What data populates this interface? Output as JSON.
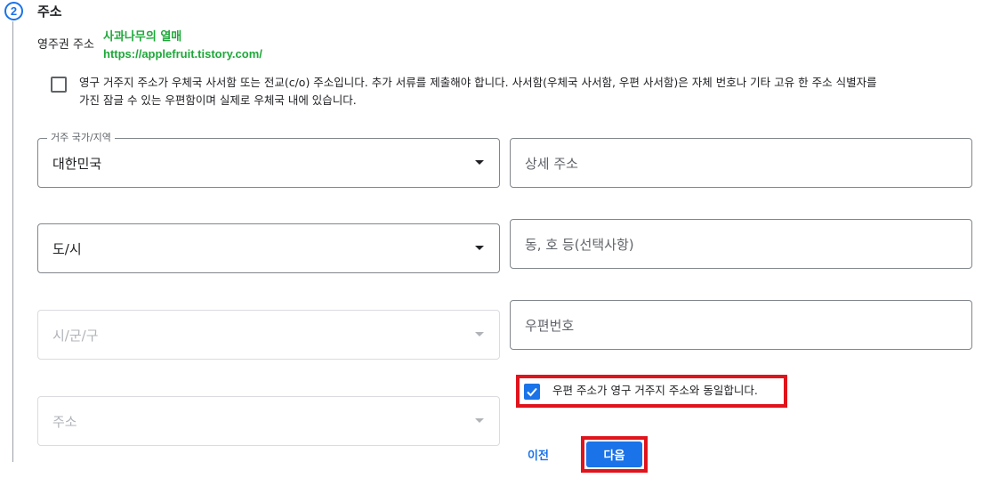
{
  "step": {
    "number": "2",
    "title": "주소"
  },
  "residency_label": "영주권 주소",
  "watermark": {
    "name": "사과나무의 열매",
    "url": "https://applefruit.tistory.com/"
  },
  "po_box": {
    "checked": false,
    "text": "영구 거주지 주소가 우체국 사서함 또는 전교(c/o) 주소입니다. 추가 서류를 제출해야 합니다. 사서함(우체국 사서함, 우편 사서함)은 자체 번호나 기타 고유 한 주소 식별자를 가진 잠글 수 있는 우편함이며 실제로 우체국 내에 있습니다."
  },
  "fields": {
    "country": {
      "label": "거주 국가/지역",
      "value": "대한민국"
    },
    "state": {
      "placeholder": "도/시"
    },
    "city": {
      "placeholder": "시/군/구"
    },
    "address": {
      "placeholder": "주소"
    },
    "detail_address": {
      "placeholder": "상세 주소"
    },
    "unit": {
      "placeholder": "동, 호 등(선택사항)"
    },
    "postal_code": {
      "placeholder": "우편번호"
    }
  },
  "same_address": {
    "checked": true,
    "text": "우편 주소가 영구 거주지 주소와 동일합니다."
  },
  "buttons": {
    "prev": "이전",
    "next": "다음"
  },
  "colors": {
    "accent": "#1a73e8",
    "highlight": "#e0141c",
    "watermark": "#1ea83a"
  }
}
